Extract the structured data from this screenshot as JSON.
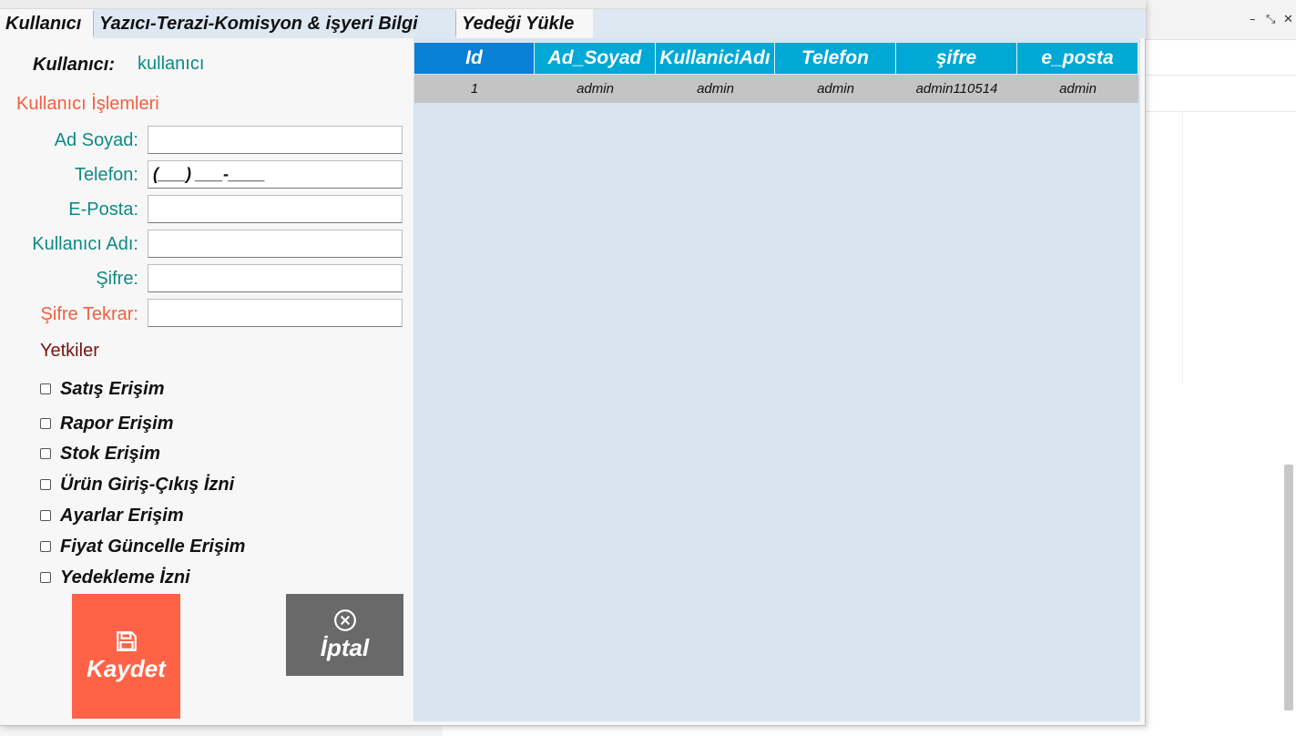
{
  "tabs": [
    {
      "label": "Kullanıcı",
      "active": true
    },
    {
      "label": "Yazıcı-Terazi-Komisyon & işyeri Bilgi",
      "active": false
    },
    {
      "label": "Yedeği Yükle",
      "active": false
    }
  ],
  "user": {
    "label": "Kullanıcı:",
    "value": "kullanıcı"
  },
  "section_title": "Kullanıcı İşlemleri",
  "form": {
    "fields": [
      {
        "label": "Ad Soyad:",
        "value": ""
      },
      {
        "label": "Telefon:",
        "value": "(___) ___-____"
      },
      {
        "label": "E-Posta:",
        "value": ""
      },
      {
        "label": "Kullanıcı Adı:",
        "value": ""
      },
      {
        "label": "Şifre:",
        "value": ""
      },
      {
        "label": "Şifre Tekrar:",
        "value": ""
      }
    ]
  },
  "permissions": {
    "title": "Yetkiler",
    "items": [
      {
        "label": "Satış Erişim",
        "checked": false
      },
      {
        "label": "Rapor Erişim",
        "checked": false
      },
      {
        "label": "Stok Erişim",
        "checked": false
      },
      {
        "label": "Ürün Giriş-Çıkış İzni",
        "checked": false
      },
      {
        "label": "Ayarlar Erişim",
        "checked": false
      },
      {
        "label": "Fiyat Güncelle Erişim",
        "checked": false
      },
      {
        "label": "Yedekleme İzni",
        "checked": false
      }
    ]
  },
  "buttons": {
    "save": "Kaydet",
    "cancel": "İptal",
    "save_icon": "floppy-disk-icon",
    "cancel_icon": "close-circle-icon"
  },
  "grid": {
    "columns": [
      "Id",
      "Ad_Soyad",
      "KullaniciAdı",
      "Telefon",
      "şifre",
      "e_posta"
    ],
    "rows": [
      [
        "1",
        "admin",
        "admin",
        "admin",
        "admin110514",
        "admin"
      ]
    ]
  },
  "colors": {
    "accent_teal": "#0e8a85",
    "accent_orange": "#f0603f",
    "save_button": "#ff6347",
    "cancel_button": "#696969",
    "grid_header": "#00a8d6",
    "grid_background": "#d8e4f0"
  }
}
